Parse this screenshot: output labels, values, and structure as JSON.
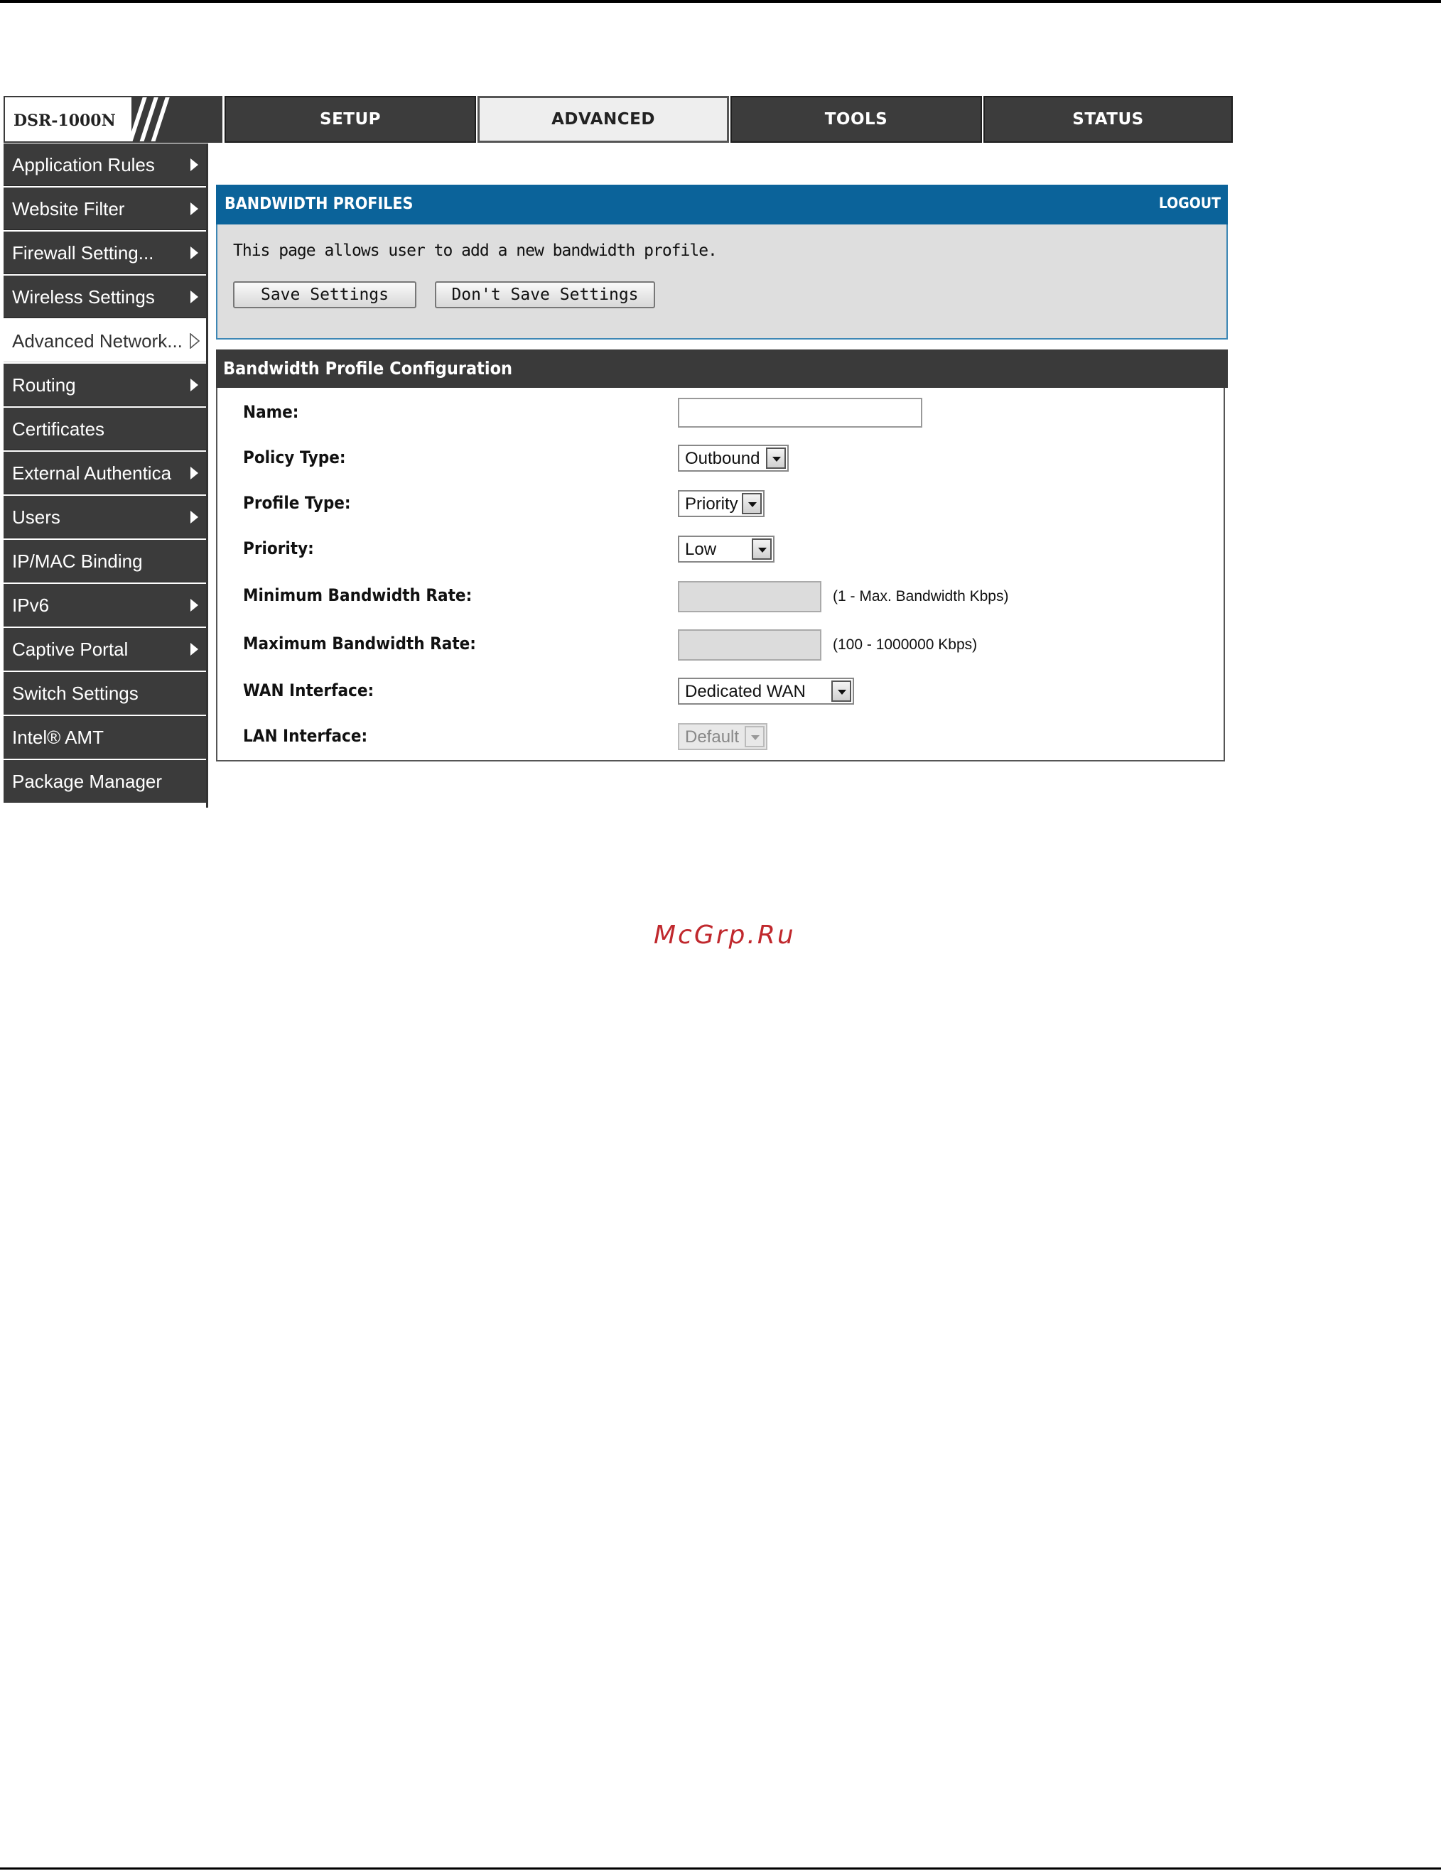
{
  "header": {
    "model": "DSR-1000N",
    "tabs": [
      {
        "label": "SETUP",
        "active": false
      },
      {
        "label": "ADVANCED",
        "active": true
      },
      {
        "label": "TOOLS",
        "active": false
      },
      {
        "label": "STATUS",
        "active": false
      }
    ]
  },
  "sidebar": {
    "items": [
      {
        "label": "Application Rules",
        "has_submenu": true
      },
      {
        "label": "Website Filter",
        "has_submenu": true
      },
      {
        "label": "Firewall Setting...",
        "has_submenu": true
      },
      {
        "label": "Wireless Settings",
        "has_submenu": true
      },
      {
        "label": "Advanced Network...",
        "has_submenu": true,
        "active": true
      },
      {
        "label": "Routing",
        "has_submenu": true
      },
      {
        "label": "Certificates",
        "has_submenu": false
      },
      {
        "label": "External Authentica",
        "has_submenu": true
      },
      {
        "label": "Users",
        "has_submenu": true
      },
      {
        "label": "IP/MAC Binding",
        "has_submenu": false
      },
      {
        "label": "IPv6",
        "has_submenu": true
      },
      {
        "label": "Captive Portal",
        "has_submenu": true
      },
      {
        "label": "Switch Settings",
        "has_submenu": false
      },
      {
        "label": "Intel® AMT",
        "has_submenu": false
      },
      {
        "label": "Package Manager",
        "has_submenu": false
      }
    ]
  },
  "panel": {
    "title": "BANDWIDTH PROFILES",
    "logout": "LOGOUT",
    "description": "This page allows user to add a new bandwidth profile.",
    "save_label": "Save Settings",
    "dont_save_label": "Don't Save Settings"
  },
  "config": {
    "title": "Bandwidth Profile Configuration",
    "name_label": "Name:",
    "name_value": "",
    "policy_type_label": "Policy Type:",
    "policy_type_value": "Outbound",
    "profile_type_label": "Profile Type:",
    "profile_type_value": "Priority",
    "priority_label": "Priority:",
    "priority_value": "Low",
    "min_rate_label": "Minimum Bandwidth Rate:",
    "min_rate_hint": "(1 - Max. Bandwidth Kbps)",
    "max_rate_label": "Maximum Bandwidth Rate:",
    "max_rate_hint": "(100 - 1000000 Kbps)",
    "wan_label": "WAN Interface:",
    "wan_value": "Dedicated WAN",
    "lan_label": "LAN Interface:",
    "lan_value": "Default"
  },
  "watermark": "McGrp.Ru"
}
